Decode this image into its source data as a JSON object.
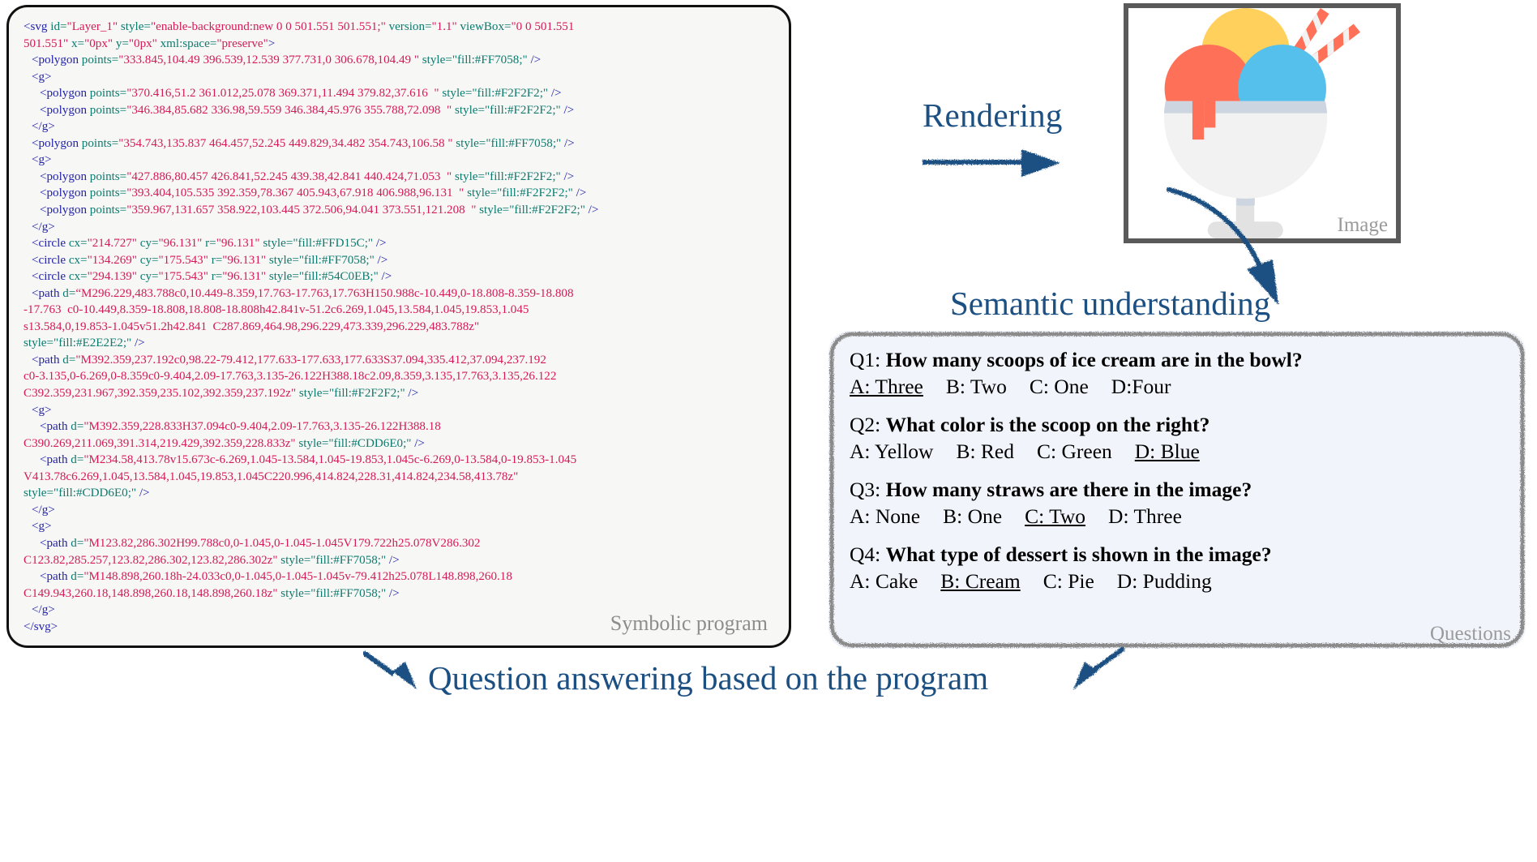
{
  "code_panel": {
    "caption": "Symbolic program",
    "lines": [
      {
        "indent": 0,
        "html": "<span class=\"tag\">&lt;svg</span> <span class=\"attr\">id=</span><span class=\"val\">\"Layer_1\"</span> <span class=\"attr\">style=</span><span class=\"val\">\"enable-background:new 0 0 501.551 501.551;\"</span> <span class=\"attr\">version=</span><span class=\"val\">\"1.1\"</span> <span class=\"attr\">viewBox=</span><span class=\"val\">\"0 0 501.551</span>"
      },
      {
        "indent": 0,
        "html": "<span class=\"val\">501.551\"</span> <span class=\"attr\">x=</span><span class=\"val\">\"0px\"</span> <span class=\"attr\">y=</span><span class=\"val\">\"0px\"</span> <span class=\"attr\">xml:space=</span><span class=\"val\">\"preserve\"</span><span class=\"tag\">&gt;</span>"
      },
      {
        "indent": 1,
        "html": "<span class=\"tag\">&lt;polygon</span> <span class=\"attr\">points=</span><span class=\"val\">\"333.845,104.49 396.539,12.539 377.731,0 306.678,104.49 \"</span> <span class=\"attr\">style=</span><span class=\"style\">\"fill:#FF7058;\"</span> <span class=\"tag\">/&gt;</span>"
      },
      {
        "indent": 1,
        "html": "<span class=\"tag\">&lt;g&gt;</span>"
      },
      {
        "indent": 2,
        "html": "<span class=\"tag\">&lt;polygon</span> <span class=\"attr\">points=</span><span class=\"val\">\"370.416,51.2 361.012,25.078 369.371,11.494 379.82,37.616  \"</span> <span class=\"attr\">style=</span><span class=\"style\">\"fill:#F2F2F2;\"</span> <span class=\"tag\">/&gt;</span>"
      },
      {
        "indent": 2,
        "html": "<span class=\"tag\">&lt;polygon</span> <span class=\"attr\">points=</span><span class=\"val\">\"346.384,85.682 336.98,59.559 346.384,45.976 355.788,72.098  \"</span> <span class=\"attr\">style=</span><span class=\"style\">\"fill:#F2F2F2;\"</span> <span class=\"tag\">/&gt;</span>"
      },
      {
        "indent": 1,
        "html": "<span class=\"tag\">&lt;/g&gt;</span>"
      },
      {
        "indent": 1,
        "html": "<span class=\"tag\">&lt;polygon</span> <span class=\"attr\">points=</span><span class=\"val\">\"354.743,135.837 464.457,52.245 449.829,34.482 354.743,106.58 \"</span> <span class=\"attr\">style=</span><span class=\"style\">\"fill:#FF7058;\"</span> <span class=\"tag\">/&gt;</span>"
      },
      {
        "indent": 1,
        "html": "<span class=\"tag\">&lt;g&gt;</span>"
      },
      {
        "indent": 2,
        "html": "<span class=\"tag\">&lt;polygon</span> <span class=\"attr\">points=</span><span class=\"val\">\"427.886,80.457 426.841,52.245 439.38,42.841 440.424,71.053  \"</span> <span class=\"attr\">style=</span><span class=\"style\">\"fill:#F2F2F2;\"</span> <span class=\"tag\">/&gt;</span>"
      },
      {
        "indent": 2,
        "html": "<span class=\"tag\">&lt;polygon</span> <span class=\"attr\">points=</span><span class=\"val\">\"393.404,105.535 392.359,78.367 405.943,67.918 406.988,96.131  \"</span> <span class=\"attr\">style=</span><span class=\"style\">\"fill:#F2F2F2;\"</span> <span class=\"tag\">/&gt;</span>"
      },
      {
        "indent": 2,
        "html": "<span class=\"tag\">&lt;polygon</span> <span class=\"attr\">points=</span><span class=\"val\">\"359.967,131.657 358.922,103.445 372.506,94.041 373.551,121.208  \"</span> <span class=\"attr\">style=</span><span class=\"style\">\"fill:#F2F2F2;\"</span> <span class=\"tag\">/&gt;</span>"
      },
      {
        "indent": 1,
        "html": "<span class=\"tag\">&lt;/g&gt;</span>"
      },
      {
        "indent": 1,
        "html": "<span class=\"tag\">&lt;circle</span> <span class=\"attr\">cx=</span><span class=\"val\">\"214.727\"</span> <span class=\"attr\">cy=</span><span class=\"val\">\"96.131\"</span> <span class=\"attr\">r=</span><span class=\"val\">\"96.131\"</span> <span class=\"attr\">style=</span><span class=\"style\">\"fill:#FFD15C;\"</span> <span class=\"tag\">/&gt;</span>"
      },
      {
        "indent": 1,
        "html": "<span class=\"tag\">&lt;circle</span> <span class=\"attr\">cx=</span><span class=\"val\">\"134.269\"</span> <span class=\"attr\">cy=</span><span class=\"val\">\"175.543\"</span> <span class=\"attr\">r=</span><span class=\"val\">\"96.131\"</span> <span class=\"attr\">style=</span><span class=\"style\">\"fill:#FF7058;\"</span> <span class=\"tag\">/&gt;</span>"
      },
      {
        "indent": 1,
        "html": "<span class=\"tag\">&lt;circle</span> <span class=\"attr\">cx=</span><span class=\"val\">\"294.139\"</span> <span class=\"attr\">cy=</span><span class=\"val\">\"175.543\"</span> <span class=\"attr\">r=</span><span class=\"val\">\"96.131\"</span> <span class=\"attr\">style=</span><span class=\"style\">\"fill:#54C0EB;\"</span> <span class=\"tag\">/&gt;</span>"
      },
      {
        "indent": 1,
        "html": "<span class=\"tag\">&lt;path</span> <span class=\"attr\">d=</span><span class=\"val\">&ldquo;M296.229,483.788c0,10.449-8.359,17.763-17.763,17.763H150.988c-10.449,0-18.808-8.359-18.808</span>"
      },
      {
        "indent": 0,
        "html": "<span class=\"val\">-17.763  c0-10.449,8.359-18.808,18.808-18.808h42.841v-51.2c6.269,1.045,13.584,1.045,19.853,1.045</span>"
      },
      {
        "indent": 0,
        "html": "<span class=\"val\">s13.584,0,19.853-1.045v51.2h42.841  C287.869,464.98,296.229,473.339,296.229,483.788z\"</span>"
      },
      {
        "indent": 0,
        "html": "<span class=\"attr\">style=</span><span class=\"style\">\"fill:#E2E2E2;\"</span> <span class=\"tag\">/&gt;</span>"
      },
      {
        "indent": 1,
        "html": "<span class=\"tag\">&lt;path</span> <span class=\"attr\">d=</span><span class=\"val\">\"M392.359,237.192c0,98.22-79.412,177.633-177.633,177.633S37.094,335.412,37.094,237.192</span>"
      },
      {
        "indent": 0,
        "html": "<span class=\"val\">c0-3.135,0-6.269,0-8.359c0-9.404,2.09-17.763,3.135-26.122H388.18c2.09,8.359,3.135,17.763,3.135,26.122</span>"
      },
      {
        "indent": 0,
        "html": "<span class=\"val\">C392.359,231.967,392.359,235.102,392.359,237.192z\"</span> <span class=\"attr\">style=</span><span class=\"style\">\"fill:#F2F2F2;\"</span> <span class=\"tag\">/&gt;</span>"
      },
      {
        "indent": 1,
        "html": "<span class=\"tag\">&lt;g&gt;</span>"
      },
      {
        "indent": 2,
        "html": "<span class=\"tag\">&lt;path</span> <span class=\"attr\">d=</span><span class=\"val\">\"M392.359,228.833H37.094c0-9.404,2.09-17.763,3.135-26.122H388.18</span>"
      },
      {
        "indent": 0,
        "html": "<span class=\"val\">C390.269,211.069,391.314,219.429,392.359,228.833z\"</span> <span class=\"attr\">style=</span><span class=\"style\">\"fill:#CDD6E0;\"</span> <span class=\"tag\">/&gt;</span>"
      },
      {
        "indent": 2,
        "html": "<span class=\"tag\">&lt;path</span> <span class=\"attr\">d=</span><span class=\"val\">\"M234.58,413.78v15.673c-6.269,1.045-13.584,1.045-19.853,1.045c-6.269,0-13.584,0-19.853-1.045</span>"
      },
      {
        "indent": 0,
        "html": "<span class=\"val\">V413.78c6.269,1.045,13.584,1.045,19.853,1.045C220.996,414.824,228.31,414.824,234.58,413.78z\"</span>"
      },
      {
        "indent": 0,
        "html": "<span class=\"attr\">style=</span><span class=\"style\">\"fill:#CDD6E0;\"</span> <span class=\"tag\">/&gt;</span>"
      },
      {
        "indent": 1,
        "html": "<span class=\"tag\">&lt;/g&gt;</span>"
      },
      {
        "indent": 1,
        "html": "<span class=\"tag\">&lt;g&gt;</span>"
      },
      {
        "indent": 2,
        "html": "<span class=\"tag\">&lt;path</span> <span class=\"attr\">d=</span><span class=\"val\">\"M123.82,286.302H99.788c0,0-1.045,0-1.045-1.045V179.722h25.078V286.302</span>"
      },
      {
        "indent": 0,
        "html": "<span class=\"val\">C123.82,285.257,123.82,286.302,123.82,286.302z\"</span> <span class=\"attr\">style=</span><span class=\"style\">\"fill:#FF7058;\"</span> <span class=\"tag\">/&gt;</span>"
      },
      {
        "indent": 2,
        "html": "<span class=\"tag\">&lt;path</span> <span class=\"attr\">d=</span><span class=\"val\">\"M148.898,260.18h-24.033c0,0-1.045,0-1.045-1.045v-79.412h25.078L148.898,260.18</span>"
      },
      {
        "indent": 0,
        "html": "<span class=\"val\">C149.943,260.18,148.898,260.18,148.898,260.18z\"</span> <span class=\"attr\">style=</span><span class=\"style\">\"fill:#FF7058;\"</span> <span class=\"tag\">/&gt;</span>"
      },
      {
        "indent": 1,
        "html": "<span class=\"tag\">&lt;/g&gt;</span>"
      },
      {
        "indent": 0,
        "html": "<span class=\"tag\">&lt;/svg&gt;</span>"
      }
    ]
  },
  "rendering": {
    "label": "Rendering"
  },
  "image_box": {
    "caption": "Image",
    "colors": {
      "scoop_yellow": "#FFD15C",
      "scoop_red": "#FF7058",
      "scoop_blue": "#54C0EB",
      "bowl_body": "#F2F2F2",
      "bowl_rim": "#CDD6E0",
      "stem": "#E2E2E2",
      "border": "#5a5a5a"
    }
  },
  "semantic": {
    "label": "Semantic understanding"
  },
  "questions_panel": {
    "caption": "Questions",
    "items": [
      {
        "id": "Q1:",
        "text": "How many scoops of ice cream are in the bowl?",
        "options": [
          {
            "label": "A: Three",
            "correct": true
          },
          {
            "label": "B: Two",
            "correct": false
          },
          {
            "label": "C: One",
            "correct": false
          },
          {
            "label": "D:Four",
            "correct": false
          }
        ]
      },
      {
        "id": "Q2:",
        "text": "What color is the scoop on the right?",
        "options": [
          {
            "label": "A: Yellow",
            "correct": false
          },
          {
            "label": "B: Red",
            "correct": false
          },
          {
            "label": "C: Green",
            "correct": false
          },
          {
            "label": "D: Blue",
            "correct": true
          }
        ]
      },
      {
        "id": "Q3:",
        "text": "How many straws are there in the image?",
        "options": [
          {
            "label": "A: None",
            "correct": false
          },
          {
            "label": "B: One",
            "correct": false
          },
          {
            "label": "C: Two",
            "correct": true
          },
          {
            "label": "D: Three",
            "correct": false
          }
        ]
      },
      {
        "id": "Q4:",
        "text": "What type of dessert is shown in the image?",
        "options": [
          {
            "label": "A: Cake",
            "correct": false
          },
          {
            "label": "B: Cream",
            "correct": true
          },
          {
            "label": "C: Pie",
            "correct": false
          },
          {
            "label": "D: Pudding",
            "correct": false
          }
        ]
      }
    ]
  },
  "bottom": {
    "label": "Question answering based on the program",
    "accent_color": "#1c4f82"
  }
}
